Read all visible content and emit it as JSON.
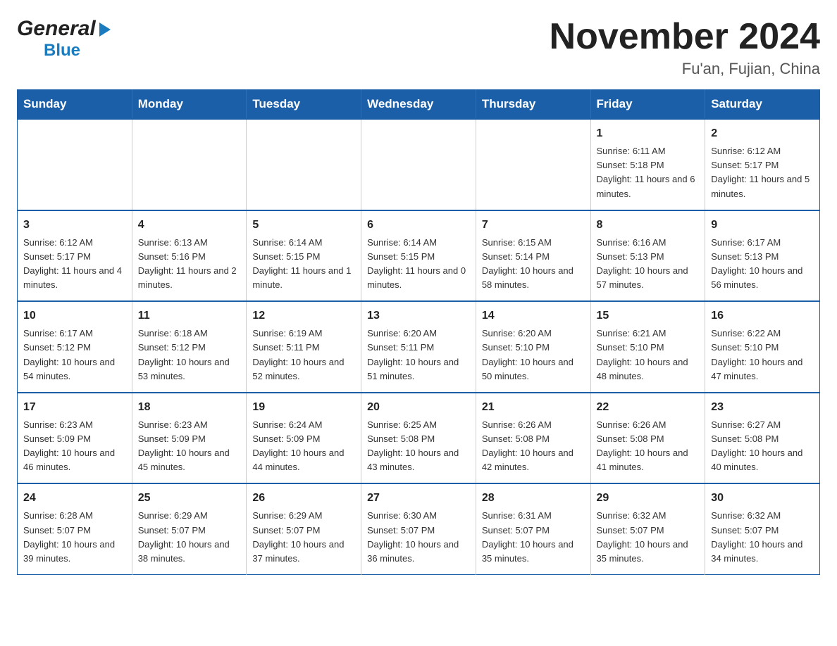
{
  "logo": {
    "general": "General",
    "blue": "Blue"
  },
  "title": "November 2024",
  "subtitle": "Fu'an, Fujian, China",
  "days_of_week": [
    "Sunday",
    "Monday",
    "Tuesday",
    "Wednesday",
    "Thursday",
    "Friday",
    "Saturday"
  ],
  "weeks": [
    [
      {
        "day": "",
        "info": ""
      },
      {
        "day": "",
        "info": ""
      },
      {
        "day": "",
        "info": ""
      },
      {
        "day": "",
        "info": ""
      },
      {
        "day": "",
        "info": ""
      },
      {
        "day": "1",
        "info": "Sunrise: 6:11 AM\nSunset: 5:18 PM\nDaylight: 11 hours and 6 minutes."
      },
      {
        "day": "2",
        "info": "Sunrise: 6:12 AM\nSunset: 5:17 PM\nDaylight: 11 hours and 5 minutes."
      }
    ],
    [
      {
        "day": "3",
        "info": "Sunrise: 6:12 AM\nSunset: 5:17 PM\nDaylight: 11 hours and 4 minutes."
      },
      {
        "day": "4",
        "info": "Sunrise: 6:13 AM\nSunset: 5:16 PM\nDaylight: 11 hours and 2 minutes."
      },
      {
        "day": "5",
        "info": "Sunrise: 6:14 AM\nSunset: 5:15 PM\nDaylight: 11 hours and 1 minute."
      },
      {
        "day": "6",
        "info": "Sunrise: 6:14 AM\nSunset: 5:15 PM\nDaylight: 11 hours and 0 minutes."
      },
      {
        "day": "7",
        "info": "Sunrise: 6:15 AM\nSunset: 5:14 PM\nDaylight: 10 hours and 58 minutes."
      },
      {
        "day": "8",
        "info": "Sunrise: 6:16 AM\nSunset: 5:13 PM\nDaylight: 10 hours and 57 minutes."
      },
      {
        "day": "9",
        "info": "Sunrise: 6:17 AM\nSunset: 5:13 PM\nDaylight: 10 hours and 56 minutes."
      }
    ],
    [
      {
        "day": "10",
        "info": "Sunrise: 6:17 AM\nSunset: 5:12 PM\nDaylight: 10 hours and 54 minutes."
      },
      {
        "day": "11",
        "info": "Sunrise: 6:18 AM\nSunset: 5:12 PM\nDaylight: 10 hours and 53 minutes."
      },
      {
        "day": "12",
        "info": "Sunrise: 6:19 AM\nSunset: 5:11 PM\nDaylight: 10 hours and 52 minutes."
      },
      {
        "day": "13",
        "info": "Sunrise: 6:20 AM\nSunset: 5:11 PM\nDaylight: 10 hours and 51 minutes."
      },
      {
        "day": "14",
        "info": "Sunrise: 6:20 AM\nSunset: 5:10 PM\nDaylight: 10 hours and 50 minutes."
      },
      {
        "day": "15",
        "info": "Sunrise: 6:21 AM\nSunset: 5:10 PM\nDaylight: 10 hours and 48 minutes."
      },
      {
        "day": "16",
        "info": "Sunrise: 6:22 AM\nSunset: 5:10 PM\nDaylight: 10 hours and 47 minutes."
      }
    ],
    [
      {
        "day": "17",
        "info": "Sunrise: 6:23 AM\nSunset: 5:09 PM\nDaylight: 10 hours and 46 minutes."
      },
      {
        "day": "18",
        "info": "Sunrise: 6:23 AM\nSunset: 5:09 PM\nDaylight: 10 hours and 45 minutes."
      },
      {
        "day": "19",
        "info": "Sunrise: 6:24 AM\nSunset: 5:09 PM\nDaylight: 10 hours and 44 minutes."
      },
      {
        "day": "20",
        "info": "Sunrise: 6:25 AM\nSunset: 5:08 PM\nDaylight: 10 hours and 43 minutes."
      },
      {
        "day": "21",
        "info": "Sunrise: 6:26 AM\nSunset: 5:08 PM\nDaylight: 10 hours and 42 minutes."
      },
      {
        "day": "22",
        "info": "Sunrise: 6:26 AM\nSunset: 5:08 PM\nDaylight: 10 hours and 41 minutes."
      },
      {
        "day": "23",
        "info": "Sunrise: 6:27 AM\nSunset: 5:08 PM\nDaylight: 10 hours and 40 minutes."
      }
    ],
    [
      {
        "day": "24",
        "info": "Sunrise: 6:28 AM\nSunset: 5:07 PM\nDaylight: 10 hours and 39 minutes."
      },
      {
        "day": "25",
        "info": "Sunrise: 6:29 AM\nSunset: 5:07 PM\nDaylight: 10 hours and 38 minutes."
      },
      {
        "day": "26",
        "info": "Sunrise: 6:29 AM\nSunset: 5:07 PM\nDaylight: 10 hours and 37 minutes."
      },
      {
        "day": "27",
        "info": "Sunrise: 6:30 AM\nSunset: 5:07 PM\nDaylight: 10 hours and 36 minutes."
      },
      {
        "day": "28",
        "info": "Sunrise: 6:31 AM\nSunset: 5:07 PM\nDaylight: 10 hours and 35 minutes."
      },
      {
        "day": "29",
        "info": "Sunrise: 6:32 AM\nSunset: 5:07 PM\nDaylight: 10 hours and 35 minutes."
      },
      {
        "day": "30",
        "info": "Sunrise: 6:32 AM\nSunset: 5:07 PM\nDaylight: 10 hours and 34 minutes."
      }
    ]
  ],
  "colors": {
    "header_bg": "#1a5fa8",
    "header_text": "#ffffff",
    "border": "#1a5fa8",
    "logo_blue": "#1a7bbf"
  }
}
